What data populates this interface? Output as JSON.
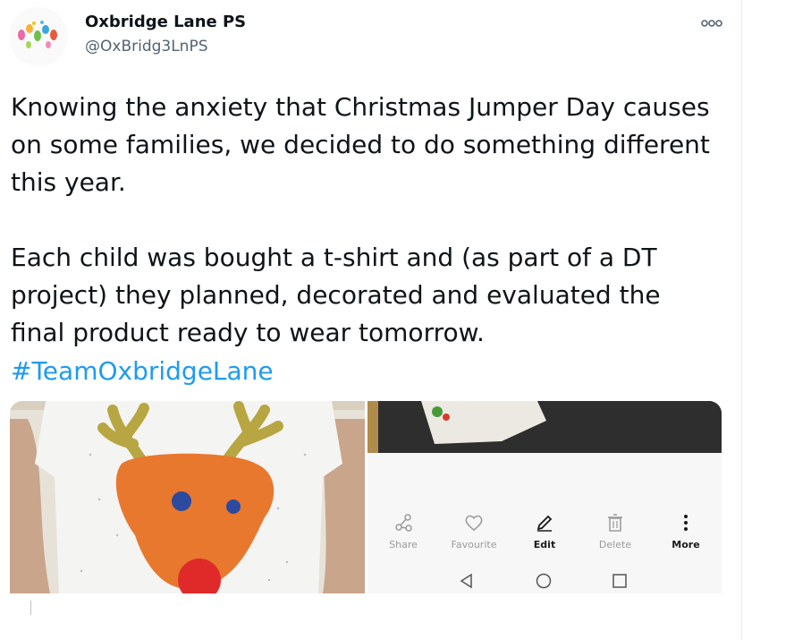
{
  "tweet": {
    "display_name": "Oxbridge Lane PS",
    "handle": "@OxBridg3LnPS",
    "text": "Knowing the anxiety that Christmas Jumper Day causes\non some families, we decided to do something different\nthis year.\n\nEach child was bought a t-shirt and (as part of a DT\nproject) they planned, decorated and evaluated the\nfinal product ready to wear tomorrow.",
    "hashtag": "#TeamOxbridgeLane",
    "more_icon": "more-horizontal-icon"
  },
  "media": {
    "phone_actions": [
      {
        "label": "Share",
        "icon": "share-icon"
      },
      {
        "label": "Favourite",
        "icon": "heart-icon"
      },
      {
        "label": "Edit",
        "icon": "pencil-icon"
      },
      {
        "label": "Delete",
        "icon": "trash-icon"
      },
      {
        "label": "More",
        "icon": "more-vertical-icon"
      }
    ],
    "phone_nav": [
      "back-icon",
      "home-icon",
      "recents-icon"
    ]
  },
  "colors": {
    "link": "#1d9bf0",
    "text": "#0f1419",
    "secondary": "#536471"
  }
}
